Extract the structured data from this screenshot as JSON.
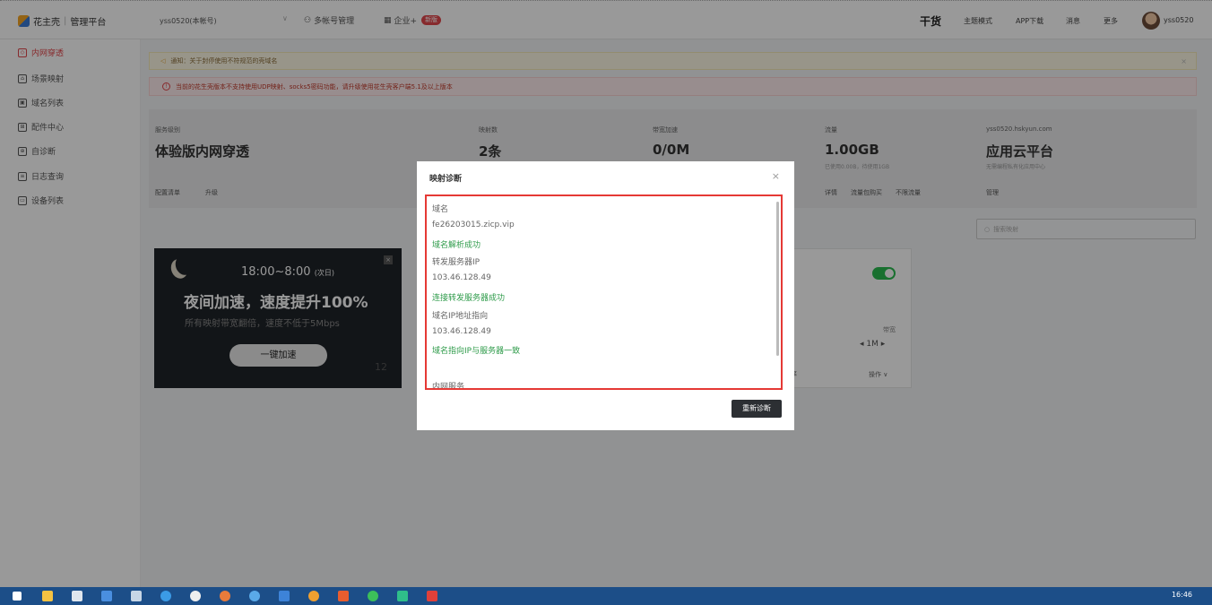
{
  "header": {
    "brand": "花主壳",
    "platform": "管理平台",
    "account": "yss0520(本帐号)",
    "multi_account": "多帐号管理",
    "enterprise": "企业+",
    "new_badge": "新版",
    "gan": "干货",
    "nav": [
      "主题模式",
      "APP下载",
      "消息",
      "更多"
    ],
    "username": "yss0520"
  },
  "sidebar": {
    "items": [
      {
        "label": "内网穿透",
        "active": true
      },
      {
        "label": "场景映射",
        "active": false
      },
      {
        "label": "域名列表",
        "active": false
      },
      {
        "label": "配件中心",
        "active": false
      },
      {
        "label": "自诊断",
        "active": false
      },
      {
        "label": "日志查询",
        "active": false
      },
      {
        "label": "设备列表",
        "active": false
      }
    ]
  },
  "notices": {
    "notice1": "通知：关于封停使用不符规范的壳域名",
    "notice2": "当前的花生壳版本不支持使用UDP映射、socks5密码功能，请升级使用花生壳客户端5.1及以上版本"
  },
  "stats": {
    "service_level_label": "服务级别",
    "service_level_value": "体验版内网穿透",
    "mapping_label": "映射数",
    "mapping_value": "2条",
    "bandwidth_label": "带宽加速",
    "bandwidth_value": "0/0M",
    "traffic_label": "流量",
    "traffic_value": "1.00GB",
    "traffic_sub": "已使用0.00B，待使用1GB",
    "cloud_label": "yss0520.hskyun.com",
    "cloud_value": "应用云平台",
    "cloud_sub": "无需编程私有化应用中心",
    "link_config": "配置清单",
    "link_upgrade": "升级",
    "link_detail": "详情",
    "link_traffic_pack": "流量包购买",
    "link_unlimited": "不限流量",
    "link_manage": "管理"
  },
  "search": {
    "placeholder": "搜索映射"
  },
  "promo": {
    "time": "18:00~8:00",
    "time_note": "(次日)",
    "headline": "夜间加速，速度提升100%",
    "sub": "所有映射带宽翻倍，速度不低于5Mbps",
    "button": "一键加速",
    "num": "12"
  },
  "card": {
    "bandwidth_label": "带宽",
    "bandwidth_value": "1M",
    "rate": "率",
    "ops": "操作"
  },
  "modal": {
    "title": "映射诊断",
    "close": "×",
    "lines": [
      {
        "text": "域名",
        "ok": false
      },
      {
        "text": "fe26203015.zicp.vip",
        "ok": false
      },
      {
        "text": "域名解析成功",
        "ok": true
      },
      {
        "text": "转发服务器IP",
        "ok": false
      },
      {
        "text": "103.46.128.49",
        "ok": false
      },
      {
        "text": "连接转发服务器成功",
        "ok": true
      },
      {
        "text": "域名IP地址指向",
        "ok": false
      },
      {
        "text": "103.46.128.49",
        "ok": false
      },
      {
        "text": "域名指向IP与服务器一致",
        "ok": true
      },
      {
        "text": "内网服务",
        "ok": false
      }
    ],
    "rediagnose": "重新诊断"
  },
  "taskbar": {
    "clock": "16:46"
  },
  "colors": {
    "accent": "#e2464b",
    "success": "#2e9b4a",
    "taskbar": "#1c4e88"
  }
}
